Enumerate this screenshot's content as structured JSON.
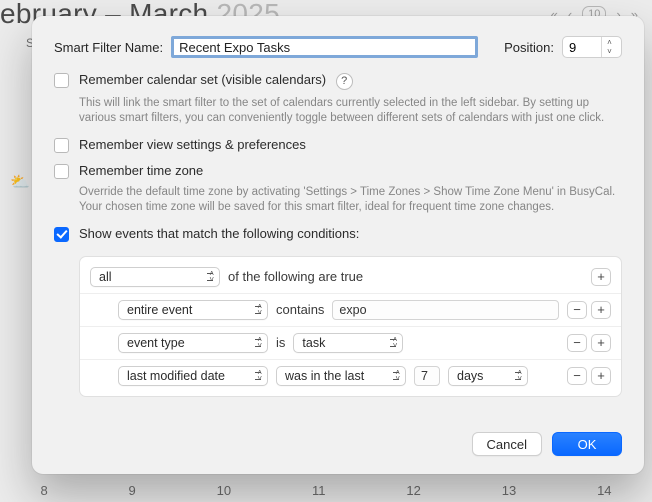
{
  "background": {
    "title_left": "ebruary – March",
    "title_year": "2025",
    "day_header_short": "S",
    "nav_today": "10",
    "bottom_days": [
      "8",
      "9",
      "10",
      "11",
      "12",
      "13",
      "14"
    ],
    "weather_glyph": "⛅"
  },
  "header": {
    "name_label": "Smart Filter Name:",
    "name_value": "Recent Expo Tasks",
    "position_label": "Position:",
    "position_value": "9"
  },
  "options": {
    "remember_calendars": {
      "label": "Remember calendar set (visible calendars)",
      "checked": false,
      "help_glyph": "?",
      "desc": "This will link the smart filter to the set of calendars currently selected in the left sidebar. By setting up various smart filters, you can conveniently toggle between different sets of calendars with just one click."
    },
    "remember_view": {
      "label": "Remember view settings & preferences",
      "checked": false
    },
    "remember_tz": {
      "label": "Remember time zone",
      "checked": false,
      "desc": "Override the default time zone by activating 'Settings > Time Zones > Show Time Zone Menu' in BusyCal. Your chosen time zone will be saved for this smart filter, ideal for frequent time zone changes."
    },
    "show_events": {
      "label": "Show events that match the following conditions:",
      "checked": true
    }
  },
  "conditions": {
    "quantifier": {
      "value": "all",
      "trail": "of the following are true"
    },
    "rows": [
      {
        "field": "entire event",
        "op_text": "contains",
        "value": "expo"
      },
      {
        "field": "event type",
        "op_text": "is",
        "value_select": "task"
      },
      {
        "field": "last modified date",
        "op_select": "was in the last",
        "num": "7",
        "unit": "days"
      }
    ]
  },
  "footer": {
    "cancel": "Cancel",
    "ok": "OK"
  },
  "glyphs": {
    "plus": "+",
    "minus": "−",
    "caret_up": "˄",
    "caret_down": "˅"
  }
}
